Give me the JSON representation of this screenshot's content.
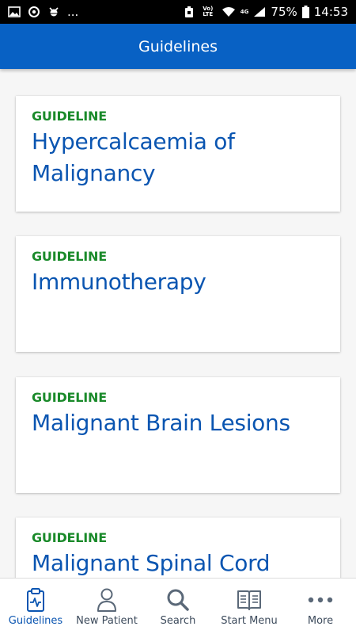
{
  "status_bar": {
    "left_icons": [
      "image-icon",
      "sync-icon",
      "bug-icon"
    ],
    "more": "...",
    "volte": "Vo) LTE",
    "network": "4G",
    "battery": "75%",
    "time": "14:53"
  },
  "app_bar": {
    "title": "Guidelines"
  },
  "cards": [
    {
      "kicker": "GUIDELINE",
      "title": "Hypercalcaemia of Malignancy"
    },
    {
      "kicker": "GUIDELINE",
      "title": "Immunotherapy"
    },
    {
      "kicker": "GUIDELINE",
      "title": "Malignant Brain Lesions"
    },
    {
      "kicker": "GUIDELINE",
      "title": "Malignant Spinal Cord"
    }
  ],
  "bottom_nav": {
    "items": [
      {
        "label": "Guidelines",
        "icon": "clipboard-pulse-icon",
        "active": true
      },
      {
        "label": "New Patient",
        "icon": "person-icon",
        "active": false
      },
      {
        "label": "Search",
        "icon": "search-icon",
        "active": false
      },
      {
        "label": "Start Menu",
        "icon": "book-icon",
        "active": false
      },
      {
        "label": "More",
        "icon": "more-dots-icon",
        "active": false
      }
    ]
  },
  "colors": {
    "app_bar": "#0861c4",
    "kicker": "#1a8a2a",
    "title": "#0a55b1",
    "nav_label": "#3d4b5c"
  }
}
